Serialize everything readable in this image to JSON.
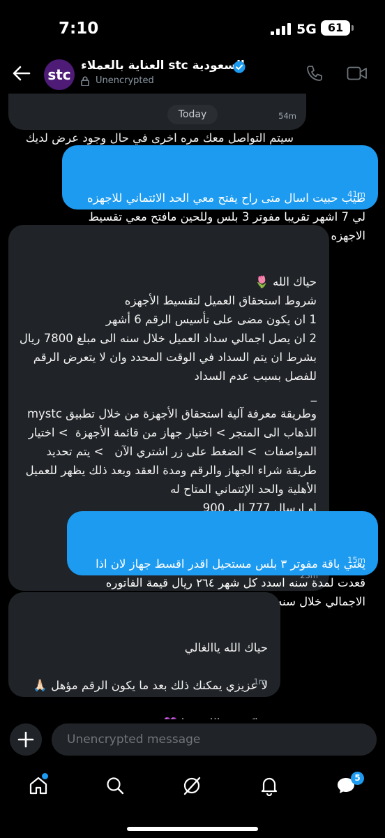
{
  "status_bar": {
    "time": "7:10",
    "network": "5G",
    "battery": "61"
  },
  "header": {
    "avatar_text": "stc",
    "name": "العناية بالعملاء stc السعودية",
    "subtitle": "Unencrypted",
    "verified_color": "#1d9bf0"
  },
  "messages": [
    {
      "id": "m1",
      "direction": "received",
      "text": "سيتم التواصل معك مره اخرى في حال وجود عرض لديك\nشكرا لتواصلك معنا 💜",
      "time": "54m"
    },
    {
      "id": "m2",
      "direction": "sent",
      "text": "طيب حبيت اسال متى راح يفتح معي الحد الائتماني للاجهزه لي 7 اشهر تقريبا مفوتر 3 بلس وللحين مافتح معي تقسيط الاجهزه",
      "time": "41m"
    },
    {
      "id": "m3",
      "direction": "received",
      "text": "حياك الله 🌷\nشروط استحقاق العميل لتقسيط الأجهزه\n1 ان يكون مضى على تأسيس الرقم 6 أشهر\n2 ان يصل اجمالي سداد العميل خلال سنه الى مبلغ 7800 ريال  بشرط ان يتم السداد في الوقت المحدد وان لا يتعرض الرقم للفصل بسبب عدم السداد\n_\nوطريقة معرفة آلية استحقاق الأجهزة من خلال تطبيق mystc الذهاب الى المتجر > اختيار جهاز من قائمة الأجهزة  > اختيار المواصفات  > الضغط على زر اشتري الآن   > يتم تحديد طريقة شراء الجهاز والرقم ومدة العقد وبعد ذلك يظهر للعميل الأهلية والحد الإئتماني المتاح له\nاو ارسال 777 الى 900\nيومك سعيد💜",
      "time": "23m"
    },
    {
      "id": "m4",
      "direction": "sent",
      "text": "يعني باقة مفوتر ٣ بلس مستحيل اقدر اقسط جهاز لان اذا قعدت لمدة سنه اسدد كل شهر ٢٦٤ ريال قيمة الفاتوره الاجمالي خلال سنه ٣١٧٤ ريال مستحيل توصل ٧٨٠٠ ؟!!",
      "time": "15m"
    },
    {
      "id": "m5",
      "direction": "received",
      "text": "حياك الله ياالغالي\n\nلا عزيزي يمكنك ذلك بعد ما يكون الرقم مؤهل 🙏🏻\n\nشاكر توصالك معنا 💜",
      "time": "1m"
    }
  ],
  "date_chip": "Today",
  "composer": {
    "placeholder": "Unencrypted message"
  },
  "nav": {
    "messages_badge": "5"
  }
}
